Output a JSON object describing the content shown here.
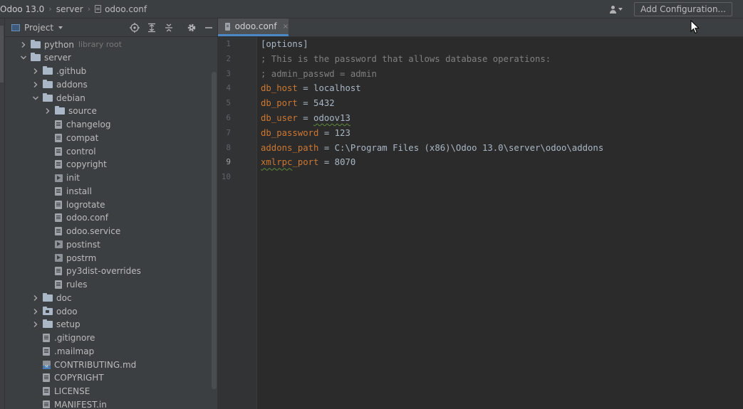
{
  "navbar": {
    "breadcrumbs": [
      "Odoo 13.0",
      "server",
      "odoo.conf"
    ],
    "add_configuration_label": "Add Configuration..."
  },
  "project_panel": {
    "title": "Project",
    "tree": [
      {
        "label": "python",
        "type": "folder",
        "depth": 1,
        "state": "collapsed",
        "suffix": "library root"
      },
      {
        "label": "server",
        "type": "folder",
        "depth": 1,
        "state": "expanded"
      },
      {
        "label": ".github",
        "type": "folder",
        "depth": 2,
        "state": "collapsed"
      },
      {
        "label": "addons",
        "type": "folder",
        "depth": 2,
        "state": "collapsed"
      },
      {
        "label": "debian",
        "type": "folder",
        "depth": 2,
        "state": "expanded"
      },
      {
        "label": "source",
        "type": "folder",
        "depth": 3,
        "state": "collapsed"
      },
      {
        "label": "changelog",
        "type": "file",
        "depth": 3
      },
      {
        "label": "compat",
        "type": "file",
        "depth": 3
      },
      {
        "label": "control",
        "type": "file",
        "depth": 3
      },
      {
        "label": "copyright",
        "type": "file",
        "depth": 3
      },
      {
        "label": "init",
        "type": "script",
        "depth": 3
      },
      {
        "label": "install",
        "type": "file",
        "depth": 3
      },
      {
        "label": "logrotate",
        "type": "file",
        "depth": 3
      },
      {
        "label": "odoo.conf",
        "type": "file",
        "depth": 3
      },
      {
        "label": "odoo.service",
        "type": "file",
        "depth": 3
      },
      {
        "label": "postinst",
        "type": "script",
        "depth": 3
      },
      {
        "label": "postrm",
        "type": "script",
        "depth": 3
      },
      {
        "label": "py3dist-overrides",
        "type": "file",
        "depth": 3
      },
      {
        "label": "rules",
        "type": "file",
        "depth": 3
      },
      {
        "label": "doc",
        "type": "folder",
        "depth": 2,
        "state": "collapsed"
      },
      {
        "label": "odoo",
        "type": "package",
        "depth": 2,
        "state": "collapsed"
      },
      {
        "label": "setup",
        "type": "folder",
        "depth": 2,
        "state": "collapsed"
      },
      {
        "label": ".gitignore",
        "type": "file",
        "depth": 2
      },
      {
        "label": ".mailmap",
        "type": "file",
        "depth": 2
      },
      {
        "label": "CONTRIBUTING.md",
        "type": "markdown",
        "depth": 2
      },
      {
        "label": "COPYRIGHT",
        "type": "file",
        "depth": 2
      },
      {
        "label": "LICENSE",
        "type": "file",
        "depth": 2
      },
      {
        "label": "MANIFEST.in",
        "type": "file",
        "depth": 2
      }
    ]
  },
  "editor": {
    "tab_label": "odoo.conf",
    "tab_close": "×",
    "current_line": 9,
    "lines": [
      {
        "n": "1",
        "tokens": [
          {
            "t": "[options]",
            "k": "section"
          }
        ]
      },
      {
        "n": "2",
        "tokens": [
          {
            "t": "; This is the password that allows database operations:",
            "k": "comment"
          }
        ]
      },
      {
        "n": "3",
        "tokens": [
          {
            "t": "; admin_passwd = admin",
            "k": "comment"
          }
        ]
      },
      {
        "n": "4",
        "tokens": [
          {
            "t": "db_host",
            "k": "key"
          },
          {
            "t": " = ",
            "k": "op"
          },
          {
            "t": "localhost",
            "k": "val"
          }
        ]
      },
      {
        "n": "5",
        "tokens": [
          {
            "t": "db_port",
            "k": "key"
          },
          {
            "t": " = ",
            "k": "op"
          },
          {
            "t": "5432",
            "k": "val"
          }
        ]
      },
      {
        "n": "6",
        "tokens": [
          {
            "t": "db_user",
            "k": "key"
          },
          {
            "t": " = ",
            "k": "op"
          },
          {
            "t": "odoov13",
            "k": "val",
            "typo": true
          }
        ]
      },
      {
        "n": "7",
        "tokens": [
          {
            "t": "db_password",
            "k": "key"
          },
          {
            "t": " = ",
            "k": "op"
          },
          {
            "t": "123",
            "k": "val"
          }
        ]
      },
      {
        "n": "8",
        "tokens": [
          {
            "t": "addons_path",
            "k": "key"
          },
          {
            "t": " = ",
            "k": "op"
          },
          {
            "t": "C:\\Program Files (x86)\\Odoo 13.0\\server\\odoo\\addons",
            "k": "val"
          }
        ]
      },
      {
        "n": "9",
        "tokens": [
          {
            "t": "xmlrpc",
            "k": "key",
            "typo": true
          },
          {
            "t": "_port",
            "k": "key"
          },
          {
            "t": " = ",
            "k": "op"
          },
          {
            "t": "8070",
            "k": "val"
          }
        ]
      },
      {
        "n": "10",
        "tokens": []
      }
    ]
  }
}
